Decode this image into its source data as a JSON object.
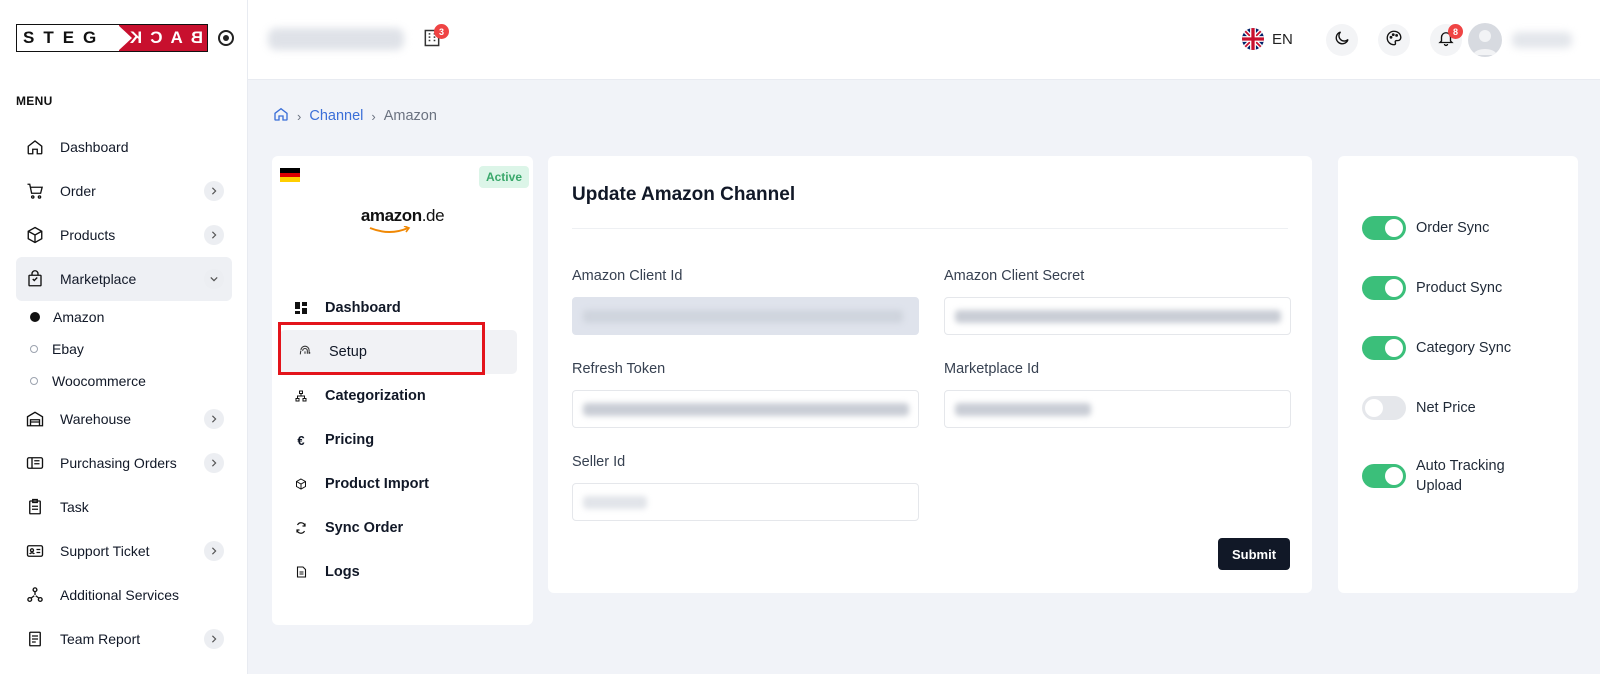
{
  "brand": {
    "left": "STEG",
    "right": "BACK"
  },
  "sidebar": {
    "menu_title": "MENU",
    "items": [
      {
        "label": "Dashboard",
        "icon": "home-icon",
        "chevron": false
      },
      {
        "label": "Order",
        "icon": "cart-icon",
        "chevron": true
      },
      {
        "label": "Products",
        "icon": "box-icon",
        "chevron": true
      },
      {
        "label": "Marketplace",
        "icon": "shopping-bag-icon",
        "chevron": true,
        "expanded": true
      }
    ],
    "subitems": [
      {
        "label": "Amazon",
        "selected": true
      },
      {
        "label": "Ebay",
        "selected": false
      },
      {
        "label": "Woocommerce",
        "selected": false
      }
    ],
    "items_after": [
      {
        "label": "Warehouse",
        "icon": "warehouse-icon",
        "chevron": true
      },
      {
        "label": "Purchasing Orders",
        "icon": "purchase-icon",
        "chevron": true
      },
      {
        "label": "Task",
        "icon": "clipboard-icon",
        "chevron": false
      },
      {
        "label": "Support Ticket",
        "icon": "id-card-icon",
        "chevron": true
      },
      {
        "label": "Additional Services",
        "icon": "services-icon",
        "chevron": false
      },
      {
        "label": "Team Report",
        "icon": "report-icon",
        "chevron": true
      }
    ]
  },
  "header": {
    "company_badge": "3",
    "language": "EN",
    "notification_badge": "8"
  },
  "breadcrumb": {
    "channel": "Channel",
    "current": "Amazon"
  },
  "channel": {
    "status": "Active",
    "logo_name": "amazon",
    "logo_tld": ".de",
    "menu": [
      {
        "label": "Dashboard",
        "icon": "dashboard-icon"
      },
      {
        "label": "Setup",
        "icon": "fingerprint-icon",
        "active": true
      },
      {
        "label": "Categorization",
        "icon": "hierarchy-icon"
      },
      {
        "label": "Pricing",
        "icon": "euro-icon"
      },
      {
        "label": "Product Import",
        "icon": "package-icon"
      },
      {
        "label": "Sync Order",
        "icon": "sync-icon"
      },
      {
        "label": "Logs",
        "icon": "file-icon"
      }
    ]
  },
  "form": {
    "title": "Update Amazon Channel",
    "client_id_label": "Amazon Client Id",
    "client_secret_label": "Amazon Client Secret",
    "refresh_token_label": "Refresh Token",
    "marketplace_id_label": "Marketplace Id",
    "seller_id_label": "Seller Id",
    "submit_label": "Submit"
  },
  "toggles": [
    {
      "label": "Order Sync",
      "on": true
    },
    {
      "label": "Product Sync",
      "on": true
    },
    {
      "label": "Category Sync",
      "on": true
    },
    {
      "label": "Net Price",
      "on": false
    },
    {
      "label": "Auto Tracking Upload",
      "on": true
    }
  ],
  "colors": {
    "accent": "#3bbf7a",
    "brand_red": "#c8102e",
    "link": "#3b6fd8",
    "highlight": "#e3141b"
  }
}
